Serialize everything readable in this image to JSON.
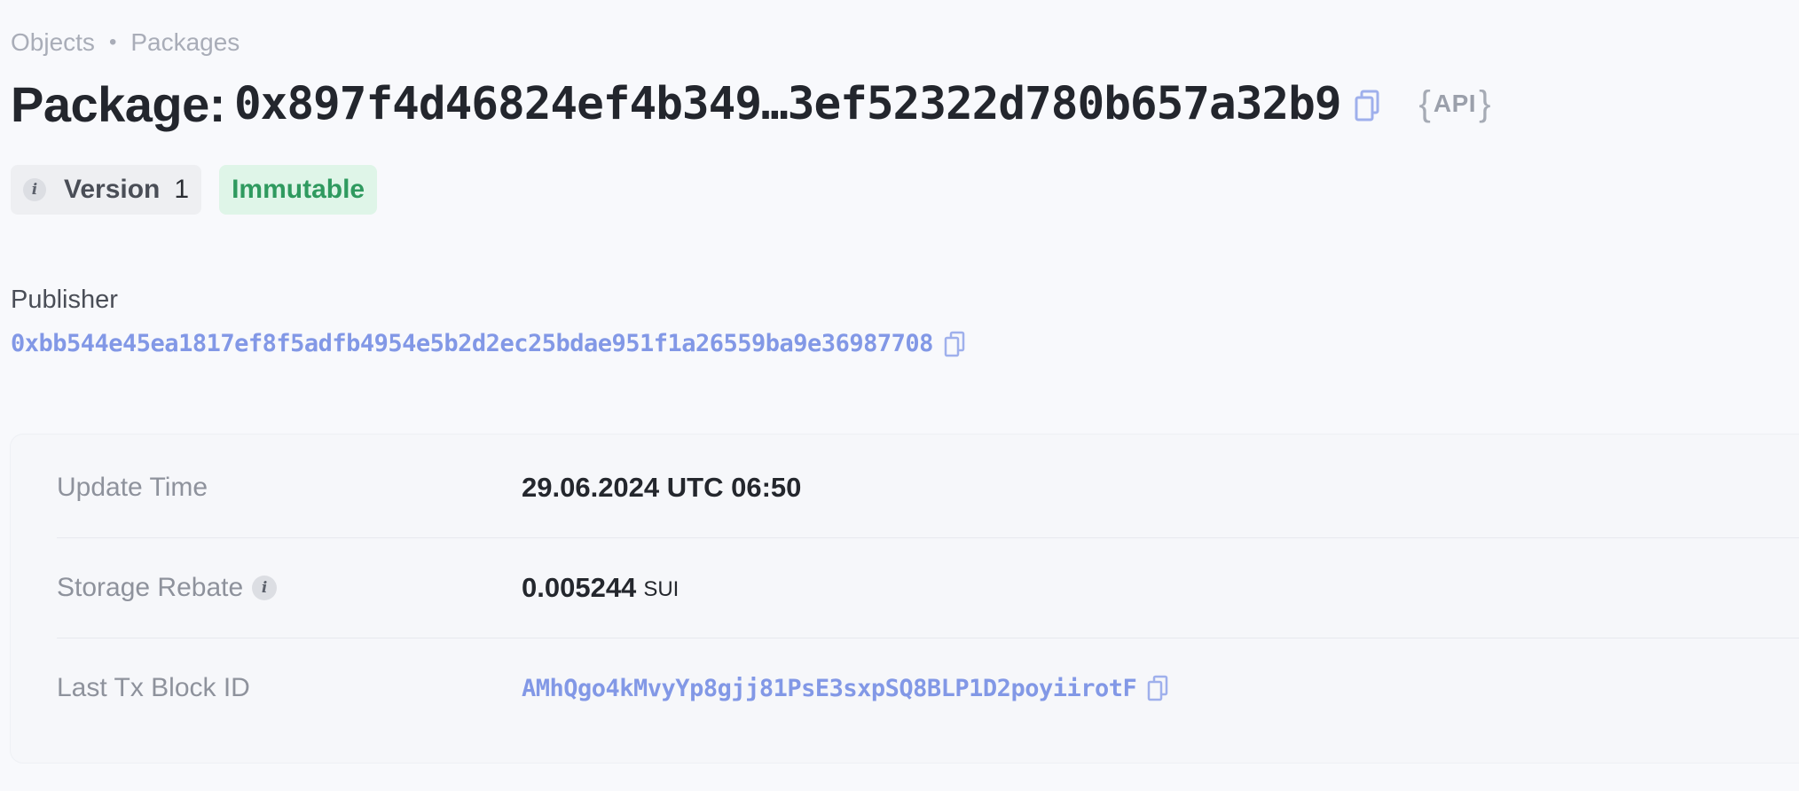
{
  "breadcrumb": {
    "items": [
      "Objects",
      "Packages"
    ],
    "separator": "•"
  },
  "header": {
    "prefix": "Package:",
    "object_id": "0x897f4d46824ef4b349…3ef52322d780b657a32b9",
    "copy_icon": "copy-icon",
    "api_label": "API"
  },
  "badges": {
    "version_label": "Version",
    "version_value": "1",
    "version_info_icon": "i",
    "status": "Immutable"
  },
  "publisher": {
    "label": "Publisher",
    "address": "0xbb544e45ea1817ef8f5adfb4954e5b2d2ec25bdae951f1a26559ba9e36987708"
  },
  "details": {
    "update_time": {
      "label": "Update Time",
      "value": "29.06.2024 UTC 06:50"
    },
    "storage_rebate": {
      "label": "Storage Rebate",
      "info_icon": "i",
      "value": "0.005244",
      "unit": "SUI"
    },
    "last_tx_block": {
      "label": "Last Tx Block ID",
      "value": "AMhQgo4kMvyYp8gjj81PsE3sxpSQ8BLP1D2poyiirotF"
    }
  },
  "colors": {
    "link": "#8298e6",
    "badge_green_bg": "#dff5e8",
    "badge_green_text": "#2f9a5f",
    "background": "#f8f9fc"
  }
}
